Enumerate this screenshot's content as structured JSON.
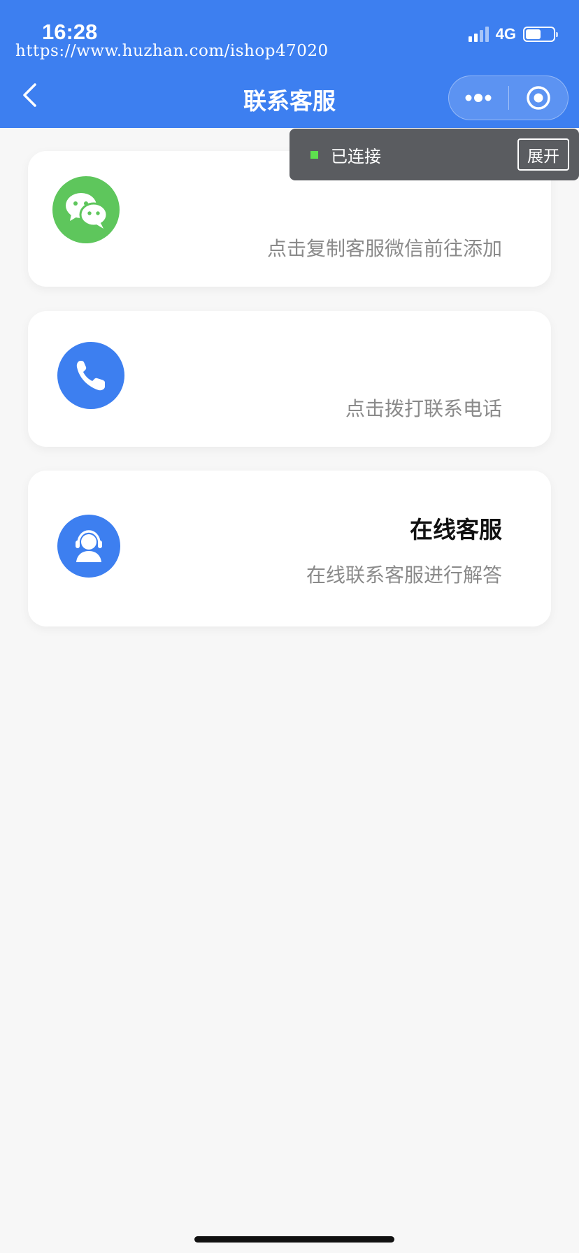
{
  "status_bar": {
    "time": "16:28",
    "network": "4G",
    "watermark": "https://www.huzhan.com/ishop47020"
  },
  "nav": {
    "title": "联系客服",
    "back_icon": "chevron-left-icon",
    "menu_icon": "more-dots-icon",
    "close_icon": "target-circle-icon"
  },
  "toast": {
    "status": "已连接",
    "expand_label": "展开",
    "status_color": "#5ee04e"
  },
  "cards": [
    {
      "icon": "wechat-icon",
      "icon_color": "#5ec65c",
      "title": "",
      "subtitle": "点击复制客服微信前往添加"
    },
    {
      "icon": "phone-icon",
      "icon_color": "#3d7ff0",
      "title": "",
      "subtitle": "点击拨打联系电话"
    },
    {
      "icon": "headset-agent-icon",
      "icon_color": "#3d7ff0",
      "title": "在线客服",
      "subtitle": "在线联系客服进行解答"
    }
  ],
  "colors": {
    "header": "#3d7ff0",
    "background": "#f7f7f7"
  }
}
